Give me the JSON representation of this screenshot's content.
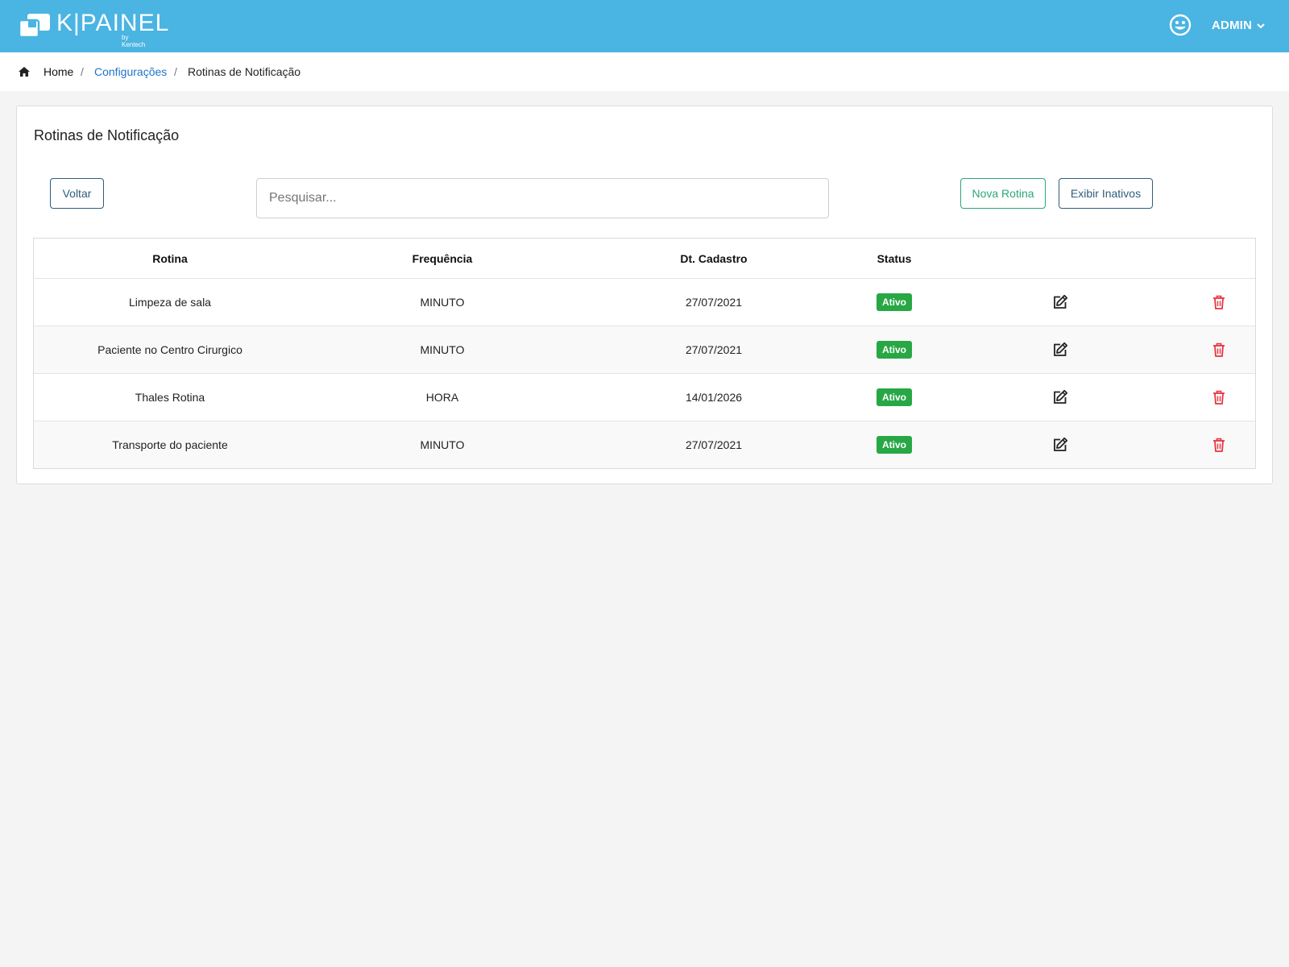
{
  "header": {
    "brand": "K|PAINEL",
    "brand_sub": "by Kentech",
    "user": "ADMIN",
    "colors": {
      "bar": "#4ab4e2"
    }
  },
  "breadcrumb": {
    "home": "Home",
    "separator": "/",
    "section": "Configurações",
    "current": "Rotinas de Notificação"
  },
  "card": {
    "title": "Rotinas de Notificação"
  },
  "toolbar": {
    "back_label": "Voltar",
    "search_placeholder": "Pesquisar...",
    "search_value": "",
    "new_label": "Nova Rotina",
    "inactive_label": "Exibir Inativos"
  },
  "table": {
    "columns": [
      "Rotina",
      "Frequência",
      "Dt. Cadastro",
      "Status"
    ],
    "rows": [
      {
        "rotina": "Limpeza de sala",
        "frequencia": "MINUTO",
        "data": "27/07/2021",
        "status": "Ativo"
      },
      {
        "rotina": "Paciente no Centro Cirurgico",
        "frequencia": "MINUTO",
        "data": "27/07/2021",
        "status": "Ativo"
      },
      {
        "rotina": "Thales Rotina",
        "frequencia": "HORA",
        "data": "14/01/2026",
        "status": "Ativo"
      },
      {
        "rotina": "Transporte do paciente",
        "frequencia": "MINUTO",
        "data": "27/07/2021",
        "status": "Ativo"
      }
    ],
    "row_actions": [
      "edit-icon",
      "trash-icon"
    ],
    "colors": {
      "status_active": "#28a745",
      "delete": "#e8343f",
      "edit": "#222222"
    }
  }
}
